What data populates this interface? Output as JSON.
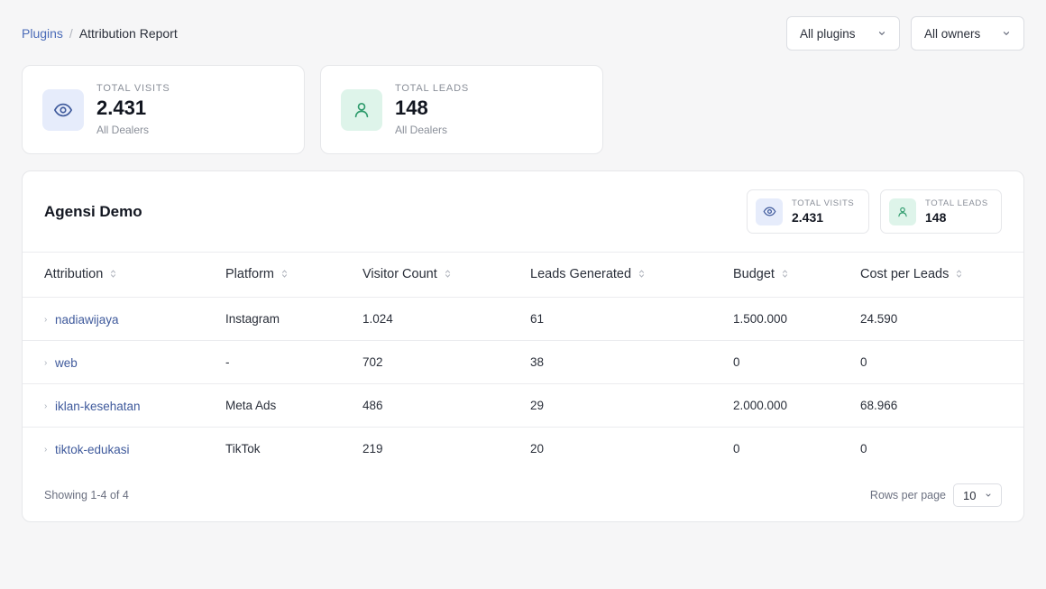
{
  "breadcrumb": {
    "parent": "Plugins",
    "separator": "/",
    "current": "Attribution Report"
  },
  "filters": {
    "plugins": "All plugins",
    "owners": "All owners"
  },
  "stats": {
    "visits": {
      "title": "TOTAL VISITS",
      "value": "2.431",
      "sub": "All Dealers"
    },
    "leads": {
      "title": "TOTAL LEADS",
      "value": "148",
      "sub": "All Dealers"
    }
  },
  "panel": {
    "title": "Agensi Demo",
    "mini": {
      "visits": {
        "title": "TOTAL VISITS",
        "value": "2.431"
      },
      "leads": {
        "title": "TOTAL LEADS",
        "value": "148"
      }
    },
    "columns": [
      "Attribution",
      "Platform",
      "Visitor Count",
      "Leads Generated",
      "Budget",
      "Cost per Leads"
    ],
    "rows": [
      [
        "nadiawijaya",
        "Instagram",
        "1.024",
        "61",
        "1.500.000",
        "24.590"
      ],
      [
        "web",
        "-",
        "702",
        "38",
        "0",
        "0"
      ],
      [
        "iklan-kesehatan",
        "Meta Ads",
        "486",
        "29",
        "2.000.000",
        "68.966"
      ],
      [
        "tiktok-edukasi",
        "TikTok",
        "219",
        "20",
        "0",
        "0"
      ]
    ],
    "footer": {
      "showing": "Showing 1-4 of 4",
      "rows_label": "Rows per page",
      "rows_value": "10"
    }
  },
  "colors": {
    "accent": "#4a6bb8",
    "link": "#3f5a9c",
    "visit_bg": "#e6ecfb",
    "lead_bg": "#def4ea"
  },
  "icons": {
    "visits": "eye-icon",
    "leads": "user-icon",
    "sort": "sort-icon",
    "chevron": "chevron-down-icon"
  }
}
